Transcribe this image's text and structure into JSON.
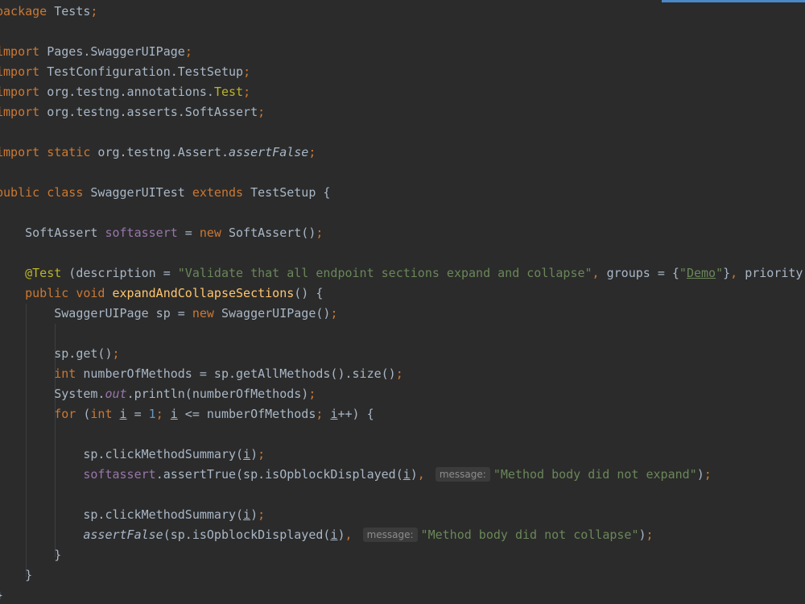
{
  "editor": {
    "language": "Java",
    "background": "#2b2b2b",
    "colors": {
      "keyword": "#cc7832",
      "string": "#6a8759",
      "number": "#6897bb",
      "annotation": "#bbb529",
      "field": "#9876aa",
      "method": "#ffc66d",
      "plain": "#a9b7c6"
    },
    "lines": [
      {
        "tokens": [
          {
            "t": "package",
            "c": "kw"
          },
          {
            "t": " Tests",
            "c": "plain"
          },
          {
            "t": ";",
            "c": "kw"
          }
        ]
      },
      {
        "tokens": []
      },
      {
        "tokens": [
          {
            "t": "import",
            "c": "kw"
          },
          {
            "t": " Pages.SwaggerUIPage",
            "c": "plain"
          },
          {
            "t": ";",
            "c": "kw"
          }
        ]
      },
      {
        "tokens": [
          {
            "t": "import",
            "c": "kw"
          },
          {
            "t": " TestConfiguration.TestSetup",
            "c": "plain"
          },
          {
            "t": ";",
            "c": "kw"
          }
        ]
      },
      {
        "tokens": [
          {
            "t": "import",
            "c": "kw"
          },
          {
            "t": " org.testng.annotations.",
            "c": "plain"
          },
          {
            "t": "Test",
            "c": "ann"
          },
          {
            "t": ";",
            "c": "kw"
          }
        ]
      },
      {
        "tokens": [
          {
            "t": "import",
            "c": "kw"
          },
          {
            "t": " org.testng.asserts.SoftAssert",
            "c": "plain"
          },
          {
            "t": ";",
            "c": "kw"
          }
        ]
      },
      {
        "tokens": []
      },
      {
        "tokens": [
          {
            "t": "import static",
            "c": "kw"
          },
          {
            "t": " org.testng.Assert.",
            "c": "plain"
          },
          {
            "t": "assertFalse",
            "c": "italic"
          },
          {
            "t": ";",
            "c": "kw"
          }
        ]
      },
      {
        "tokens": []
      },
      {
        "tokens": [
          {
            "t": "public class",
            "c": "kw"
          },
          {
            "t": " SwaggerUITest ",
            "c": "plain"
          },
          {
            "t": "extends",
            "c": "kw"
          },
          {
            "t": " TestSetup {",
            "c": "plain"
          }
        ]
      },
      {
        "tokens": []
      },
      {
        "tokens": [
          {
            "t": "    SoftAssert ",
            "c": "plain"
          },
          {
            "t": "softassert",
            "c": "field"
          },
          {
            "t": " = ",
            "c": "plain"
          },
          {
            "t": "new",
            "c": "kw"
          },
          {
            "t": " SoftAssert()",
            "c": "plain"
          },
          {
            "t": ";",
            "c": "kw"
          }
        ]
      },
      {
        "tokens": []
      },
      {
        "tokens": [
          {
            "t": "    ",
            "c": "plain"
          },
          {
            "t": "@Test",
            "c": "ann"
          },
          {
            "t": " (description = ",
            "c": "plain"
          },
          {
            "t": "\"Validate that all endpoint sections expand and collapse\"",
            "c": "str"
          },
          {
            "t": ",",
            "c": "kw"
          },
          {
            "t": " groups = {",
            "c": "plain"
          },
          {
            "t": "\"",
            "c": "str"
          },
          {
            "t": "Demo",
            "c": "strlink"
          },
          {
            "t": "\"",
            "c": "str"
          },
          {
            "t": "}",
            "c": "plain"
          },
          {
            "t": ",",
            "c": "kw"
          },
          {
            "t": " priority",
            "c": "plain"
          }
        ]
      },
      {
        "tokens": [
          {
            "t": "    ",
            "c": "plain"
          },
          {
            "t": "public void",
            "c": "kw"
          },
          {
            "t": " ",
            "c": "plain"
          },
          {
            "t": "expandAndCollapseSections",
            "c": "method"
          },
          {
            "t": "() {",
            "c": "plain"
          }
        ]
      },
      {
        "tokens": [
          {
            "t": "        SwaggerUIPage sp = ",
            "c": "plain"
          },
          {
            "t": "new",
            "c": "kw"
          },
          {
            "t": " SwaggerUIPage()",
            "c": "plain"
          },
          {
            "t": ";",
            "c": "kw"
          }
        ]
      },
      {
        "tokens": []
      },
      {
        "tokens": [
          {
            "t": "        sp.get()",
            "c": "plain"
          },
          {
            "t": ";",
            "c": "kw"
          }
        ]
      },
      {
        "tokens": [
          {
            "t": "        ",
            "c": "plain"
          },
          {
            "t": "int",
            "c": "kw"
          },
          {
            "t": " numberOfMethods = sp.getAllMethods().size()",
            "c": "plain"
          },
          {
            "t": ";",
            "c": "kw"
          }
        ]
      },
      {
        "tokens": [
          {
            "t": "        System.",
            "c": "plain"
          },
          {
            "t": "out",
            "c": "fielditalic"
          },
          {
            "t": ".println(numberOfMethods)",
            "c": "plain"
          },
          {
            "t": ";",
            "c": "kw"
          }
        ]
      },
      {
        "tokens": [
          {
            "t": "        ",
            "c": "plain"
          },
          {
            "t": "for",
            "c": "kw"
          },
          {
            "t": " (",
            "c": "plain"
          },
          {
            "t": "int",
            "c": "kw"
          },
          {
            "t": " ",
            "c": "plain"
          },
          {
            "t": "i",
            "c": "varul"
          },
          {
            "t": " = ",
            "c": "plain"
          },
          {
            "t": "1",
            "c": "num"
          },
          {
            "t": ";",
            "c": "kw"
          },
          {
            "t": " ",
            "c": "plain"
          },
          {
            "t": "i",
            "c": "varul"
          },
          {
            "t": " <= numberOfMethods",
            "c": "plain"
          },
          {
            "t": ";",
            "c": "kw"
          },
          {
            "t": " ",
            "c": "plain"
          },
          {
            "t": "i",
            "c": "varul"
          },
          {
            "t": "++) {",
            "c": "plain"
          }
        ]
      },
      {
        "tokens": []
      },
      {
        "tokens": [
          {
            "t": "            sp.clickMethodSummary(",
            "c": "plain"
          },
          {
            "t": "i",
            "c": "varul"
          },
          {
            "t": ")",
            "c": "plain"
          },
          {
            "t": ";",
            "c": "kw"
          }
        ]
      },
      {
        "tokens": [
          {
            "t": "            ",
            "c": "plain"
          },
          {
            "t": "softassert",
            "c": "field"
          },
          {
            "t": ".assertTrue(sp.isOpblockDisplayed(",
            "c": "plain"
          },
          {
            "t": "i",
            "c": "varul"
          },
          {
            "t": ")",
            "c": "plain"
          },
          {
            "t": ",",
            "c": "kw"
          },
          {
            "t": " ",
            "c": "plain"
          },
          {
            "t": "message:",
            "c": "hint"
          },
          {
            "t": "\"Method body did not expand\"",
            "c": "str"
          },
          {
            "t": ")",
            "c": "plain"
          },
          {
            "t": ";",
            "c": "kw"
          }
        ]
      },
      {
        "tokens": []
      },
      {
        "tokens": [
          {
            "t": "            sp.clickMethodSummary(",
            "c": "plain"
          },
          {
            "t": "i",
            "c": "varul"
          },
          {
            "t": ")",
            "c": "plain"
          },
          {
            "t": ";",
            "c": "kw"
          }
        ]
      },
      {
        "tokens": [
          {
            "t": "            ",
            "c": "plain"
          },
          {
            "t": "assertFalse",
            "c": "italic"
          },
          {
            "t": "(sp.isOpblockDisplayed(",
            "c": "plain"
          },
          {
            "t": "i",
            "c": "varul"
          },
          {
            "t": ")",
            "c": "plain"
          },
          {
            "t": ",",
            "c": "kw"
          },
          {
            "t": " ",
            "c": "plain"
          },
          {
            "t": "message:",
            "c": "hint"
          },
          {
            "t": "\"Method body did not collapse\"",
            "c": "str"
          },
          {
            "t": ")",
            "c": "plain"
          },
          {
            "t": ";",
            "c": "kw"
          }
        ]
      },
      {
        "tokens": [
          {
            "t": "        }",
            "c": "plain"
          }
        ]
      },
      {
        "tokens": [
          {
            "t": "    }",
            "c": "plain"
          }
        ]
      },
      {
        "tokens": [
          {
            "t": "}",
            "c": "plain"
          }
        ]
      }
    ]
  }
}
